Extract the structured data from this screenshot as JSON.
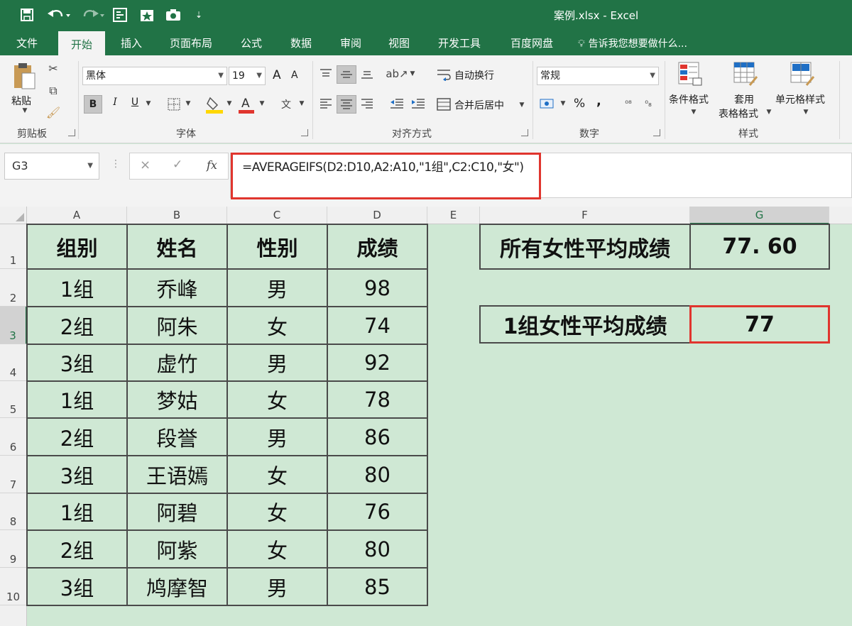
{
  "title_bar": {
    "title": "案例.xlsx - Excel",
    "qa_icons": [
      "save-icon",
      "undo-icon",
      "redo-icon",
      "form-icon",
      "star-icon",
      "camera-icon",
      "customize-icon"
    ]
  },
  "tabs": [
    "文件",
    "开始",
    "插入",
    "页面布局",
    "公式",
    "数据",
    "审阅",
    "视图",
    "开发工具",
    "百度网盘"
  ],
  "tell_me": "告诉我您想要做什么...",
  "ribbon": {
    "clipboard": {
      "paste": "粘贴",
      "label": "剪贴板"
    },
    "font": {
      "name": "黑体",
      "size": "19",
      "grow": "A",
      "shrink": "A",
      "bold": "B",
      "italic": "I",
      "underline": "U",
      "label": "字体"
    },
    "alignment": {
      "wrap": "自动换行",
      "merge": "合并后居中",
      "label": "对齐方式"
    },
    "number": {
      "format": "常规",
      "percent": "%",
      "comma": ",",
      "label": "数字"
    },
    "styles": {
      "conditional": "条件格式",
      "table_line1": "套用",
      "table_line2": "表格格式",
      "cell_styles": "单元格样式",
      "label": "样式"
    }
  },
  "formula_bar": {
    "name_box": "G3",
    "cancel": "×",
    "enter": "✓",
    "fx": "fx",
    "formula": "=AVERAGEIFS(D2:D10,A2:A10,\"1组\",C2:C10,\"女\")"
  },
  "columns": [
    "A",
    "B",
    "C",
    "D",
    "E",
    "F",
    "G"
  ],
  "rows": [
    "1",
    "2",
    "3",
    "4",
    "5",
    "6",
    "7",
    "8",
    "9",
    "10"
  ],
  "table": {
    "headers": [
      "组别",
      "姓名",
      "性别",
      "成绩"
    ],
    "rows": [
      [
        "1组",
        "乔峰",
        "男",
        "98"
      ],
      [
        "2组",
        "阿朱",
        "女",
        "74"
      ],
      [
        "3组",
        "虚竹",
        "男",
        "92"
      ],
      [
        "1组",
        "梦姑",
        "女",
        "78"
      ],
      [
        "2组",
        "段誉",
        "男",
        "86"
      ],
      [
        "3组",
        "王语嫣",
        "女",
        "80"
      ],
      [
        "1组",
        "阿碧",
        "女",
        "76"
      ],
      [
        "2组",
        "阿紫",
        "女",
        "80"
      ],
      [
        "3组",
        "鸠摩智",
        "男",
        "85"
      ]
    ]
  },
  "summary": {
    "all_female_label": "所有女性平均成绩",
    "all_female_value": "77. 60",
    "group1_female_label": "1组女性平均成绩",
    "group1_female_value": "77"
  },
  "colors": {
    "excel_green": "#217346",
    "sheet_bg": "#cfe8d4",
    "highlight_red": "#e0352e"
  }
}
